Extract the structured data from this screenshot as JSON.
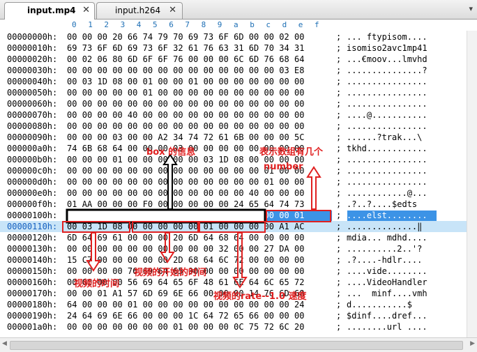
{
  "tabs": [
    {
      "label": "input.mp4",
      "close": "✕",
      "active": true
    },
    {
      "label": "input.h264",
      "close": "✕",
      "active": false
    }
  ],
  "tab_menu_icon": "▾",
  "column_header": [
    "0",
    "1",
    "2",
    "3",
    "4",
    "5",
    "6",
    "7",
    "8",
    "9",
    "a",
    "b",
    "c",
    "d",
    "e",
    "f"
  ],
  "rows": [
    {
      "offset": "00000000h:",
      "hex": "00 00 00 20 66 74 79 70 69 73 6F 6D 00 00 02 00",
      "ascii": "... ftypisom...."
    },
    {
      "offset": "00000010h:",
      "hex": "69 73 6F 6D 69 73 6F 32 61 76 63 31 6D 70 34 31",
      "ascii": "isomiso2avc1mp41"
    },
    {
      "offset": "00000020h:",
      "hex": "00 02 06 80 6D 6F 6F 76 00 00 00 6C 6D 76 68 64",
      "ascii": "...€moov...lmvhd"
    },
    {
      "offset": "00000030h:",
      "hex": "00 00 00 00 00 00 00 00 00 00 00 00 00 00 03 E8",
      "ascii": "...............?"
    },
    {
      "offset": "00000040h:",
      "hex": "00 03 1D 08 00 01 00 00 01 00 00 00 00 00 00 00",
      "ascii": "................"
    },
    {
      "offset": "00000050h:",
      "hex": "00 00 00 00 00 01 00 00 00 00 00 00 00 00 00 00",
      "ascii": "................"
    },
    {
      "offset": "00000060h:",
      "hex": "00 00 00 00 00 00 00 00 00 00 00 00 00 00 00 00",
      "ascii": "................"
    },
    {
      "offset": "00000070h:",
      "hex": "00 00 00 00 40 00 00 00 00 00 00 00 00 00 00 00",
      "ascii": "....@..........."
    },
    {
      "offset": "00000080h:",
      "hex": "00 00 00 00 00 00 00 00 00 00 00 00 00 00 00 00",
      "ascii": "................"
    },
    {
      "offset": "00000090h:",
      "hex": "00 00 00 03 00 00 A2 34 74 72 61 6B 00 00 00 5C",
      "ascii": "......?trak...\\"
    },
    {
      "offset": "000000a0h:",
      "hex": "74 6B 68 64 00 00 00 03 00 00 00 00 00 00 00 00",
      "ascii": "tkhd............"
    },
    {
      "offset": "000000b0h:",
      "hex": "00 00 00 01 00 00 00 00 00 03 1D 08 00 00 00 00",
      "ascii": "................"
    },
    {
      "offset": "000000c0h:",
      "hex": "00 00 00 00 00 00 00 00 00 00 00 00 00 01 00 00",
      "ascii": "................"
    },
    {
      "offset": "000000d0h:",
      "hex": "00 00 00 00 00 00 00 00 00 00 00 00 00 01 00 00",
      "ascii": "................"
    },
    {
      "offset": "000000e0h:",
      "hex": "00 00 00 00 00 00 00 00 00 00 00 00 40 00 00 00",
      "ascii": "............@..."
    },
    {
      "offset": "000000f0h:",
      "hex": "01 AA 00 00 00 F0 00 00 00 00 00 24 65 64 74 73",
      "ascii": ".?..?....$edts"
    },
    {
      "offset": "00000100h:",
      "hex": "00 00 00 1C 65 6C 73 74 00 00 00 00 00 00 00 01",
      "ascii": "....elst........"
    },
    {
      "offset": "00000110h:",
      "hex": "00 03 1D 08 00 00 00 00 00 01 00 00 00 00 A1 AC",
      "ascii": "..............‖"
    },
    {
      "offset": "00000120h:",
      "hex": "6D 64 69 61 00 00 00 20 6D 64 68 64 00 00 00 00",
      "ascii": "mdia... mdhd...."
    },
    {
      "offset": "00000130h:",
      "hex": "00 00 00 00 00 00 00 00 00 00 32 00 00 27 DA 00",
      "ascii": "..........2..'?"
    },
    {
      "offset": "00000140h:",
      "hex": "15 C7 00 00 00 00 00 2D 68 64 6C 72 00 00 00 00",
      "ascii": ".?....-hdlr...."
    },
    {
      "offset": "00000150h:",
      "hex": "00 00 00 00 76 69 64 65 00 00 00 00 00 00 00 00",
      "ascii": "....vide........"
    },
    {
      "offset": "00000160h:",
      "hex": "00 00 00 00 56 69 64 65 6F 48 61 6E 64 6C 65 72",
      "ascii": "....VideoHandler"
    },
    {
      "offset": "00000170h:",
      "hex": "00 00 01 A1 57 6D 69 6E 66 00 00 00 14 76 6D 68",
      "ascii": "...  minf....vmh"
    },
    {
      "offset": "00000180h:",
      "hex": "64 00 00 00 01 00 00 00 00 00 00 00 00 00 00 24",
      "ascii": "d...........$"
    },
    {
      "offset": "00000190h:",
      "hex": "24 64 69 6E 66 00 00 00 1C 64 72 65 66 00 00 00",
      "ascii": "$dinf....dref..."
    },
    {
      "offset": "000001a0h:",
      "hex": "00 00 00 00 00 00 00 01 00 00 00 0C 75 72 6C 20",
      "ascii": "........url ...."
    }
  ],
  "separator": ";",
  "annotations": {
    "box_info": "box 的信息",
    "array_count": "表示数组有几个",
    "number": "number",
    "video_start_time": "视频的开始的时间",
    "video_time": "视频的时间",
    "video_rate": "视频的rate--1.0 速度"
  },
  "colors": {
    "annotation": "#e02020",
    "selection": "#3c93e6",
    "row_highlight": "#c8e4f8",
    "offset_blue": "#1560c0"
  }
}
